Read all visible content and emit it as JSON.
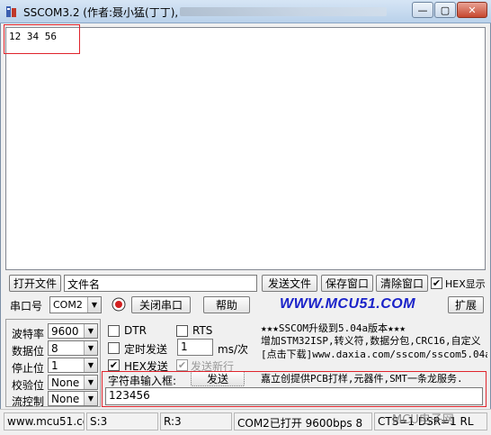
{
  "window": {
    "title": "SSCOM3.2 (作者:聂小猛(丁丁),",
    "min_label": "—",
    "max_label": "▢",
    "close_label": "✕"
  },
  "receive": {
    "text": "12 34 56"
  },
  "row1": {
    "open_file": "打开文件",
    "file_name": "文件名",
    "send_file": "发送文件",
    "save_window": "保存窗口",
    "clear_window": "清除窗口",
    "hex_display_label": "HEX显示",
    "hex_display_checked": "✔"
  },
  "row2": {
    "port_label": "串口号",
    "port_value": "COM2",
    "close_port": "关闭串口",
    "help": "帮助",
    "brand": "WWW.MCU51.COM",
    "expand": "扩展"
  },
  "settings": {
    "baud_label": "波特率",
    "baud_value": "9600",
    "databits_label": "数据位",
    "databits_value": "8",
    "stopbits_label": "停止位",
    "stopbits_value": "1",
    "parity_label": "校验位",
    "parity_value": "None",
    "flow_label": "流控制",
    "flow_value": "None"
  },
  "options": {
    "dtr": "DTR",
    "rts": "RTS",
    "timed_send": "定时发送",
    "interval_value": "1",
    "interval_unit": "ms/次",
    "hex_send": "HEX发送",
    "hex_send_checked": "✔",
    "send_newline": "发送新行",
    "send_newline_checked": "✔",
    "input_label": "字符串输入框:",
    "send_button": "发送",
    "input_value": "123456"
  },
  "ad": {
    "line1": "★★★SSCOM升级到5.04a版本★★★",
    "line2": "增加STM32ISP,转义符,数据分包,CRC16,自定义",
    "line3": "[点击下载]www.daxia.com/sscom/sscom5.04a.r",
    "line4": "嘉立创提供PCB打样,元器件,SMT一条龙服务."
  },
  "status": {
    "website": "www.mcu51.cor",
    "sent": "S:3",
    "received": "R:3",
    "port_state": "COM2已打开  9600bps  8",
    "lines": "CTS=1 DSR=1 RL"
  },
  "watermark": "MCU电子网"
}
